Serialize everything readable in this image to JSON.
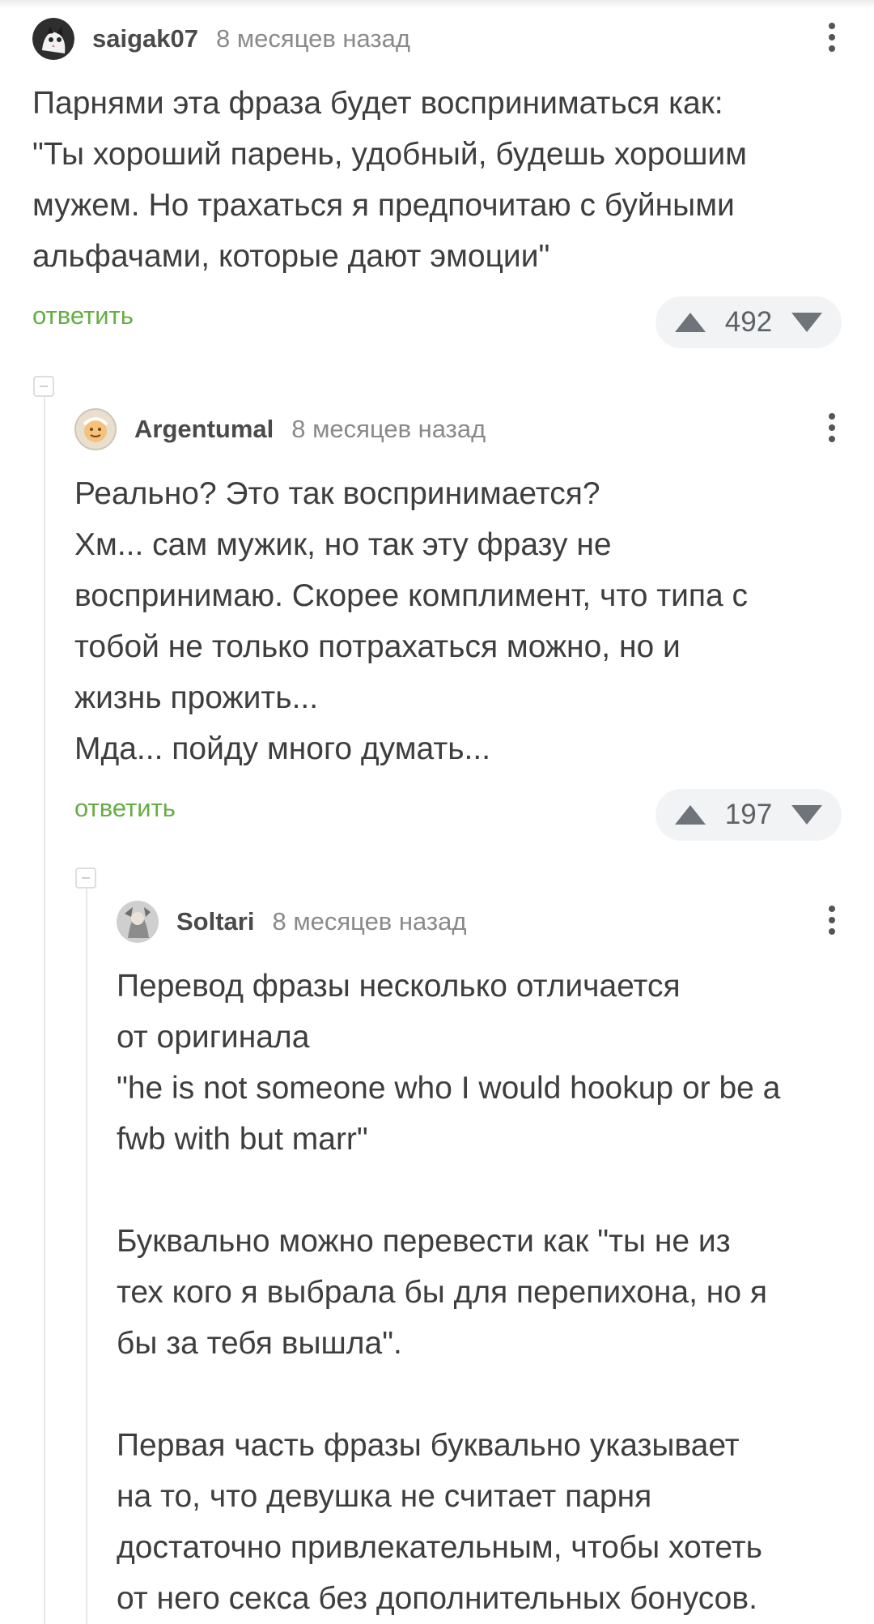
{
  "comments": [
    {
      "username": "saigak07",
      "time": "8 месяцев назад",
      "text": "Парнями эта фраза будет восприниматься как:\n\"Ты хороший парень, удобный, будешь хорошим\nмужем. Но трахаться я предпочитаю с буйными\nальфачами, которые дают эмоции\"",
      "reply_label": "ответить",
      "score": "492"
    },
    {
      "username": "Argentumal",
      "time": "8 месяцев назад",
      "text": "Реально? Это так воспринимается?\nХм... сам мужик, но так эту фразу не\nвоспринимаю. Скорее комплимент, что типа с\nтобой не только потрахаться можно, но и\nжизнь прожить...\nМда... пойду много думать...",
      "reply_label": "ответить",
      "score": "197"
    },
    {
      "username": "Soltari",
      "time": "8 месяцев назад",
      "text": "Перевод фразы несколько отличается\nот оригинала\n\"he is not someone who I would hookup or be a\nfwb with but marr\"\n\nБуквально можно перевести как \"ты не из\nтех кого я выбрала бы для перепихона, но я\nбы за тебя вышла\".\n\nПервая часть фразы буквально указывает\nна то, что девушка не считает парня\nдостаточно привлекательным, чтобы хотеть\nот него секса без дополнительных бонусов."
    }
  ],
  "colors": {
    "reply": "#66ad45",
    "text": "#3e3e3e",
    "meta": "#8a8a8a",
    "vote_bg": "#f2f3f5"
  },
  "icons": [
    "more-vertical-icon",
    "upvote-icon",
    "downvote-icon",
    "collapse-icon"
  ]
}
